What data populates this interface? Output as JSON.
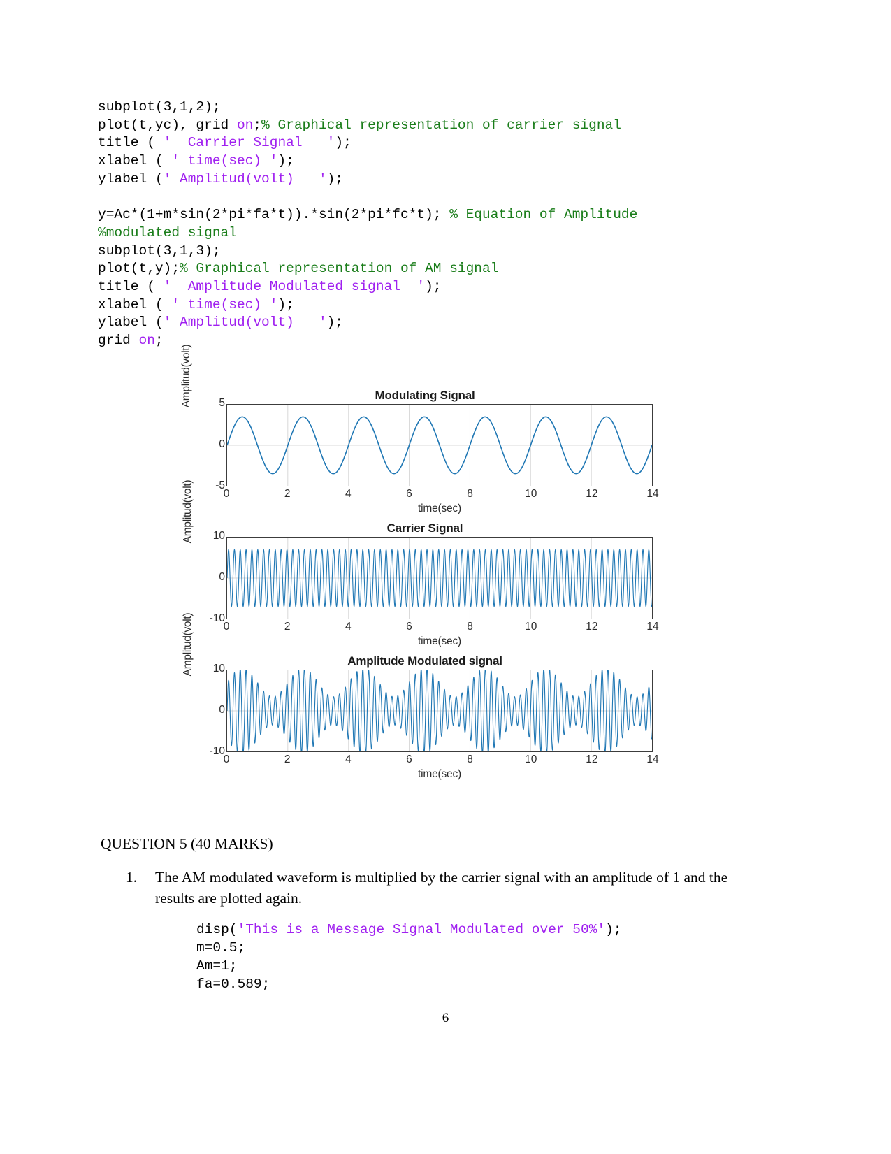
{
  "document": {
    "page_number": "6",
    "question_heading": "QUESTION 5 (40 MARKS)",
    "list": [
      {
        "marker": "1.",
        "text": "The AM modulated waveform is multiplied by the carrier signal with an amplitude of 1 and the results are plotted again."
      }
    ]
  },
  "code_top": {
    "lines": [
      [
        {
          "t": "subplot(3,1,2);",
          "c": "plain"
        }
      ],
      [
        {
          "t": "plot(t,yc), grid ",
          "c": "plain"
        },
        {
          "t": "on",
          "c": "kw"
        },
        {
          "t": ";",
          "c": "plain"
        },
        {
          "t": "% Graphical representation of carrier signal",
          "c": "comment"
        }
      ],
      [
        {
          "t": "title ( ",
          "c": "plain"
        },
        {
          "t": "'  Carrier Signal   '",
          "c": "string"
        },
        {
          "t": ");",
          "c": "plain"
        }
      ],
      [
        {
          "t": "xlabel ( ",
          "c": "plain"
        },
        {
          "t": "' time(sec) '",
          "c": "string"
        },
        {
          "t": ");",
          "c": "plain"
        }
      ],
      [
        {
          "t": "ylabel (",
          "c": "plain"
        },
        {
          "t": "' Amplitud(volt)   '",
          "c": "string"
        },
        {
          "t": ");",
          "c": "plain"
        }
      ],
      [],
      [
        {
          "t": "y=Ac*(1+m*sin(2*pi*fa*t)).*sin(2*pi*fc*t); ",
          "c": "plain"
        },
        {
          "t": "% Equation of Amplitude",
          "c": "comment"
        }
      ],
      [
        {
          "t": "%modulated signal",
          "c": "comment"
        }
      ],
      [
        {
          "t": "subplot(3,1,3);",
          "c": "plain"
        }
      ],
      [
        {
          "t": "plot(t,y);",
          "c": "plain"
        },
        {
          "t": "% Graphical representation of AM signal",
          "c": "comment"
        }
      ],
      [
        {
          "t": "title ( ",
          "c": "plain"
        },
        {
          "t": "'  Amplitude Modulated signal  '",
          "c": "string"
        },
        {
          "t": ");",
          "c": "plain"
        }
      ],
      [
        {
          "t": "xlabel ( ",
          "c": "plain"
        },
        {
          "t": "' time(sec) '",
          "c": "string"
        },
        {
          "t": ");",
          "c": "plain"
        }
      ],
      [
        {
          "t": "ylabel (",
          "c": "plain"
        },
        {
          "t": "' Amplitud(volt)   '",
          "c": "string"
        },
        {
          "t": ");",
          "c": "plain"
        }
      ],
      [
        {
          "t": "grid ",
          "c": "plain"
        },
        {
          "t": "on",
          "c": "kw"
        },
        {
          "t": ";",
          "c": "plain"
        }
      ]
    ]
  },
  "code_bottom": {
    "lines": [
      [
        {
          "t": "disp(",
          "c": "plain"
        },
        {
          "t": "'This is a Message Signal Modulated over 50%'",
          "c": "string"
        },
        {
          "t": ");",
          "c": "plain"
        }
      ],
      [
        {
          "t": "m=0.5;",
          "c": "plain"
        }
      ],
      [
        {
          "t": "Am=1;",
          "c": "plain"
        }
      ],
      [
        {
          "t": "fa=0.589;",
          "c": "plain"
        }
      ]
    ]
  },
  "chart_data": [
    {
      "type": "line",
      "name": "modulating-signal",
      "title": "Modulating Signal",
      "xlabel": "time(sec)",
      "ylabel": "Amplitud(volt)",
      "xlim": [
        0,
        14
      ],
      "ylim": [
        -5,
        5
      ],
      "xticks": [
        0,
        2,
        4,
        6,
        8,
        10,
        12,
        14
      ],
      "yticks": [
        -5,
        0,
        5
      ],
      "grid": true,
      "color": "#1f77b4",
      "waveform": "sine",
      "amplitude": 3.5,
      "frequency": 0.589,
      "phase_offset": 0,
      "cycles_shown": 7,
      "description": "Am*sin(2*pi*fa*t) modulating sine, 7 cycles from t=0 to t=14"
    },
    {
      "type": "line",
      "name": "carrier-signal",
      "title": "Carrier Signal",
      "xlabel": "time(sec)",
      "ylabel": "Amplitud(volt)",
      "xlim": [
        0,
        14
      ],
      "ylim": [
        -10,
        10
      ],
      "xticks": [
        0,
        2,
        4,
        6,
        8,
        10,
        12,
        14
      ],
      "yticks": [
        -10,
        0,
        10
      ],
      "grid": true,
      "color": "#1f77b4",
      "waveform": "sine",
      "amplitude": 7,
      "frequency": 5.2,
      "description": "Ac*sin(2*pi*fc*t) dense carrier sine, constant amplitude 7"
    },
    {
      "type": "line",
      "name": "amplitude-modulated-signal",
      "title": "Amplitude Modulated signal",
      "xlabel": "time(sec)",
      "ylabel": "Amplitud(volt)",
      "xlim": [
        0,
        14
      ],
      "ylim": [
        -10,
        10
      ],
      "xticks": [
        0,
        2,
        4,
        6,
        8,
        10,
        12,
        14
      ],
      "yticks": [
        -10,
        0,
        10
      ],
      "grid": true,
      "color": "#1f77b4",
      "carrier_amplitude": 7,
      "carrier_frequency": 5.2,
      "modulation_index": 0.5,
      "modulating_frequency": 0.589,
      "envelope_peak": 10,
      "envelope_min": 3.5,
      "description": "Ac*(1+m*sin(2*pi*fa*t)).*sin(2*pi*fc*t) AM waveform with visible envelope"
    }
  ]
}
